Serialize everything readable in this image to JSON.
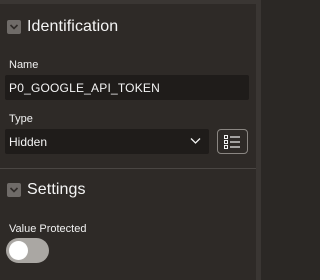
{
  "identification": {
    "title": "Identification",
    "name_label": "Name",
    "name_value": "P0_GOOGLE_API_TOKEN",
    "type_label": "Type",
    "type_value": "Hidden"
  },
  "settings": {
    "title": "Settings",
    "value_protected_label": "Value Protected",
    "value_protected_on": false
  },
  "icons": {
    "collapse": "chevron-down-icon",
    "select": "chevron-down-icon",
    "list": "list-icon"
  }
}
